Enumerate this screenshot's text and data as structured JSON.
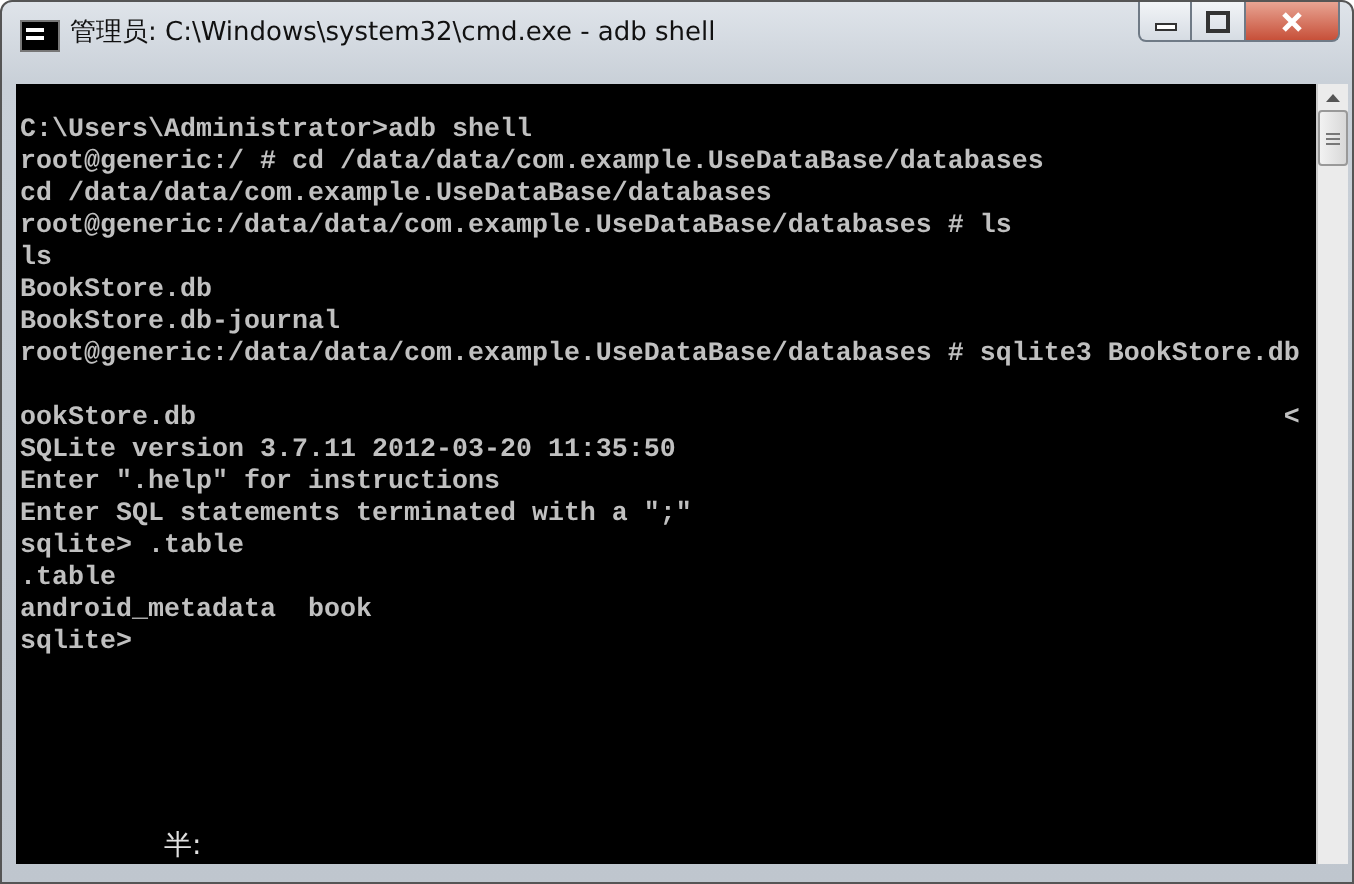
{
  "window": {
    "title": "管理员: C:\\Windows\\system32\\cmd.exe - adb  shell"
  },
  "console": {
    "lines": [
      {
        "kind": "blank"
      },
      {
        "kind": "text",
        "text": "C:\\Users\\Administrator>adb shell"
      },
      {
        "kind": "text",
        "text": "root@generic:/ # cd /data/data/com.example.UseDataBase/databases"
      },
      {
        "kind": "text",
        "text": "cd /data/data/com.example.UseDataBase/databases"
      },
      {
        "kind": "text",
        "text": "root@generic:/data/data/com.example.UseDataBase/databases # ls"
      },
      {
        "kind": "text",
        "text": "ls"
      },
      {
        "kind": "text",
        "text": "BookStore.db"
      },
      {
        "kind": "text",
        "text": "BookStore.db-journal"
      },
      {
        "kind": "text",
        "text": "root@generic:/data/data/com.example.UseDataBase/databases # sqlite3 BookStore.db"
      },
      {
        "kind": "blank"
      },
      {
        "kind": "text",
        "text": "ookStore.db",
        "right_text": "<"
      },
      {
        "kind": "text",
        "text": "SQLite version 3.7.11 2012-03-20 11:35:50"
      },
      {
        "kind": "text",
        "text": "Enter \".help\" for instructions"
      },
      {
        "kind": "text",
        "text": "Enter SQL statements terminated with a \";\""
      },
      {
        "kind": "text",
        "text": "sqlite> .table"
      },
      {
        "kind": "text",
        "text": ".table"
      },
      {
        "kind": "text",
        "text": "android_metadata  book"
      },
      {
        "kind": "text",
        "text": "sqlite>"
      }
    ],
    "ime_status": "半:"
  }
}
